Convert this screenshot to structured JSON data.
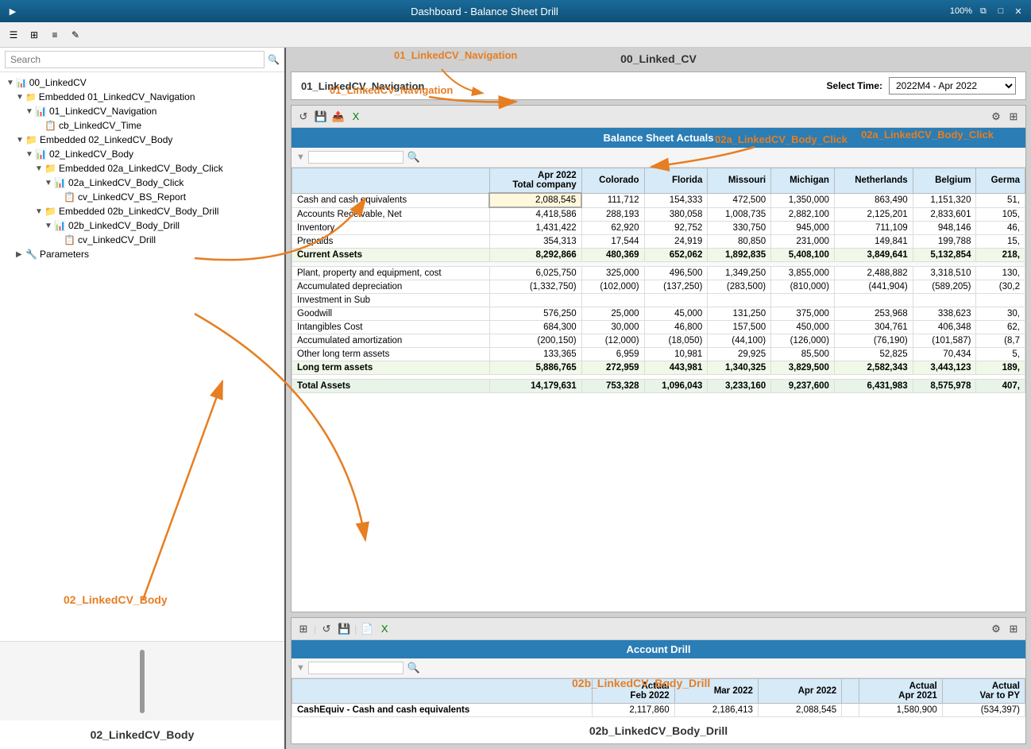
{
  "titleBar": {
    "appIcon": "▶",
    "title": "Dashboard - Balance Sheet Drill",
    "zoomLevel": "100%",
    "restoreIcon": "⧉",
    "maxIcon": "□",
    "closeIcon": "✕"
  },
  "toolbar": {
    "icons": [
      "☰",
      "⊞",
      "≡",
      "✎"
    ]
  },
  "leftPanel": {
    "searchPlaceholder": "Search",
    "treeItems": [
      {
        "id": "root",
        "indent": 0,
        "arrow": "▼",
        "icon": "cv",
        "label": "00_LinkedCV",
        "expanded": true
      },
      {
        "id": "emb01",
        "indent": 1,
        "arrow": "▼",
        "icon": "embedded",
        "label": "Embedded 01_LinkedCV_Navigation",
        "expanded": true
      },
      {
        "id": "cv01",
        "indent": 2,
        "arrow": "▼",
        "icon": "cv",
        "label": "01_LinkedCV_Navigation",
        "expanded": true
      },
      {
        "id": "cb_time",
        "indent": 3,
        "arrow": " ",
        "icon": "report",
        "label": "cb_LinkedCV_Time",
        "expanded": false
      },
      {
        "id": "emb02",
        "indent": 1,
        "arrow": "▼",
        "icon": "embedded",
        "label": "Embedded 02_LinkedCV_Body",
        "expanded": true
      },
      {
        "id": "cv02",
        "indent": 2,
        "arrow": "▼",
        "icon": "cv",
        "label": "02_LinkedCV_Body",
        "expanded": true
      },
      {
        "id": "emb02a",
        "indent": 3,
        "arrow": "▼",
        "icon": "embedded",
        "label": "Embedded 02a_LinkedCV_Body_Click",
        "expanded": true
      },
      {
        "id": "cv02a",
        "indent": 4,
        "arrow": "▼",
        "icon": "cv",
        "label": "02a_LinkedCV_Body_Click",
        "expanded": true
      },
      {
        "id": "cv_bs",
        "indent": 5,
        "arrow": " ",
        "icon": "report",
        "label": "cv_LinkedCV_BS_Report",
        "expanded": false
      },
      {
        "id": "emb02b",
        "indent": 3,
        "arrow": "▼",
        "icon": "embedded",
        "label": "Embedded 02b_LinkedCV_Body_Drill",
        "expanded": true
      },
      {
        "id": "cv02b",
        "indent": 4,
        "arrow": "▼",
        "icon": "cv",
        "label": "02b_LinkedCV_Body_Drill",
        "expanded": true
      },
      {
        "id": "cv_drill",
        "indent": 5,
        "arrow": " ",
        "icon": "report",
        "label": "cv_LinkedCV_Drill",
        "expanded": false
      },
      {
        "id": "params",
        "indent": 1,
        "arrow": "▶",
        "icon": "params",
        "label": "Parameters",
        "expanded": false
      }
    ],
    "bottomLabel": "02_LinkedCV_Body"
  },
  "rightPanel": {
    "topTitle": "00_Linked_CV",
    "navSection": {
      "label": "01_LinkedCV_Navigation",
      "selectTimeLabel": "Select Time:",
      "selectTimeValue": "2022M4 - Apr 2022"
    },
    "balanceSheet": {
      "title": "Balance Sheet Actuals",
      "annotationLabel": "02a_LinkedCV_Body_Click",
      "columns": [
        "",
        "Apr 2022\nTotal company",
        "Colorado",
        "Florida",
        "Missouri",
        "Michigan",
        "Netherlands",
        "Belgium",
        "Germa"
      ],
      "rows": [
        {
          "label": "Cash and cash equivalents",
          "bold": false,
          "values": [
            "2,088,545",
            "111,712",
            "154,333",
            "472,500",
            "1,350,000",
            "863,490",
            "1,151,320",
            "51,"
          ]
        },
        {
          "label": "Accounts Receivable, Net",
          "bold": false,
          "values": [
            "4,418,586",
            "288,193",
            "380,058",
            "1,008,735",
            "2,882,100",
            "2,125,201",
            "2,833,601",
            "105,"
          ]
        },
        {
          "label": "Inventory",
          "bold": false,
          "values": [
            "1,431,422",
            "62,920",
            "92,752",
            "330,750",
            "945,000",
            "711,109",
            "948,146",
            "46,"
          ]
        },
        {
          "label": "Prepaids",
          "bold": false,
          "values": [
            "354,313",
            "17,544",
            "24,919",
            "80,850",
            "231,000",
            "149,841",
            "199,788",
            "15,"
          ]
        },
        {
          "label": "Current Assets",
          "bold": true,
          "subtotal": true,
          "values": [
            "8,292,866",
            "480,369",
            "652,062",
            "1,892,835",
            "5,408,100",
            "3,849,641",
            "5,132,854",
            "218,"
          ]
        },
        {
          "label": "",
          "bold": false,
          "values": [
            "",
            "",
            "",
            "",
            "",
            "",
            "",
            ""
          ]
        },
        {
          "label": "Plant, property and equipment, cost",
          "bold": false,
          "values": [
            "6,025,750",
            "325,000",
            "496,500",
            "1,349,250",
            "3,855,000",
            "2,488,882",
            "3,318,510",
            "130,"
          ]
        },
        {
          "label": "Accumulated depreciation",
          "bold": false,
          "values": [
            "(1,332,750)",
            "(102,000)",
            "(137,250)",
            "(283,500)",
            "(810,000)",
            "(441,904)",
            "(589,205)",
            "(30,2"
          ]
        },
        {
          "label": "Investment in Sub",
          "bold": false,
          "values": [
            "",
            "",
            "",
            "",
            "",
            "",
            "",
            ""
          ]
        },
        {
          "label": "Goodwill",
          "bold": false,
          "values": [
            "576,250",
            "25,000",
            "45,000",
            "131,250",
            "375,000",
            "253,968",
            "338,623",
            "30,"
          ]
        },
        {
          "label": "Intangibles Cost",
          "bold": false,
          "values": [
            "684,300",
            "30,000",
            "46,800",
            "157,500",
            "450,000",
            "304,761",
            "406,348",
            "62,"
          ]
        },
        {
          "label": "Accumulated amortization",
          "bold": false,
          "values": [
            "(200,150)",
            "(12,000)",
            "(18,050)",
            "(44,100)",
            "(126,000)",
            "(76,190)",
            "(101,587)",
            "(8,7"
          ]
        },
        {
          "label": "Other long term assets",
          "bold": false,
          "values": [
            "133,365",
            "6,959",
            "10,981",
            "29,925",
            "85,500",
            "52,825",
            "70,434",
            "5,"
          ]
        },
        {
          "label": "Long term assets",
          "bold": true,
          "subtotal": true,
          "values": [
            "5,886,765",
            "272,959",
            "443,981",
            "1,340,325",
            "3,829,500",
            "2,582,343",
            "3,443,123",
            "189,"
          ]
        },
        {
          "label": "",
          "bold": false,
          "values": [
            "",
            "",
            "",
            "",
            "",
            "",
            "",
            ""
          ]
        },
        {
          "label": "Total Assets",
          "bold": true,
          "total": true,
          "values": [
            "14,179,631",
            "753,328",
            "1,096,043",
            "3,233,160",
            "9,237,600",
            "6,431,983",
            "8,575,978",
            "407,"
          ]
        }
      ]
    },
    "drillSection": {
      "title": "Account Drill",
      "bottomLabel": "02b_LinkedCV_Body_Drill",
      "columns": [
        "",
        "Actual\nFeb 2022",
        "Mar 2022",
        "Apr 2022",
        "",
        "Actual\nApr 2021",
        "Actual\nVar to PY"
      ],
      "rows": [
        {
          "label": "CashEquiv - Cash and cash equivalents",
          "values": [
            "2,117,860",
            "2,186,413",
            "2,088,545",
            "",
            "1,580,900",
            "(534,397)"
          ]
        }
      ]
    }
  },
  "annotations": {
    "navArrowLabel": "01_LinkedCV_Navigation",
    "bodyClickLabel": "02a_LinkedCV_Body_Click",
    "bodyDrillLabel": "02b_LinkedCV_Body_Drill",
    "bodyLabel": "02_LinkedCV_Body"
  }
}
